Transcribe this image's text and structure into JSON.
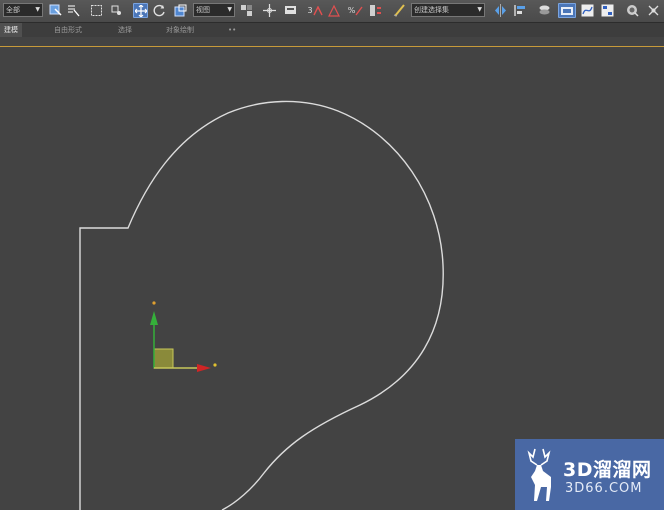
{
  "toolbar": {
    "selection_filter": "全部",
    "coord_system": "视图",
    "named_selection_set": "创建选择集",
    "snaps_angle_label": "3",
    "snaps_percent_label": "%",
    "icons": [
      "undo-icon",
      "select-object-icon",
      "select-by-name-icon",
      "rect-region-icon",
      "window-crossing-icon",
      "select-move-icon",
      "select-rotate-icon",
      "select-scale-icon",
      "use-pivot-icon",
      "select-manipulate-icon",
      "keyboard-shortcut-icon",
      "snaps-toggle-icon",
      "angle-snap-icon",
      "percent-snap-icon",
      "spinner-snap-icon",
      "edit-named-sets-icon",
      "mirror-icon",
      "align-icon",
      "layer-manager-icon",
      "graphite-tools-icon",
      "curve-editor-icon",
      "schematic-view-icon",
      "material-editor-icon",
      "render-setup-icon",
      "render-icon"
    ]
  },
  "ribbon": {
    "tabs": [
      "建模",
      "自由形式",
      "选择",
      "对象绘制",
      "••"
    ]
  },
  "viewport": {
    "colors": {
      "background": "#434343",
      "spline": "#dcdcdc",
      "gizmo_y": "#35b03a",
      "gizmo_x": "#d02525",
      "gizmo_plane": "#b7b74a"
    }
  },
  "watermark": {
    "brand": "3D溜溜网",
    "url": "3D66.COM"
  }
}
